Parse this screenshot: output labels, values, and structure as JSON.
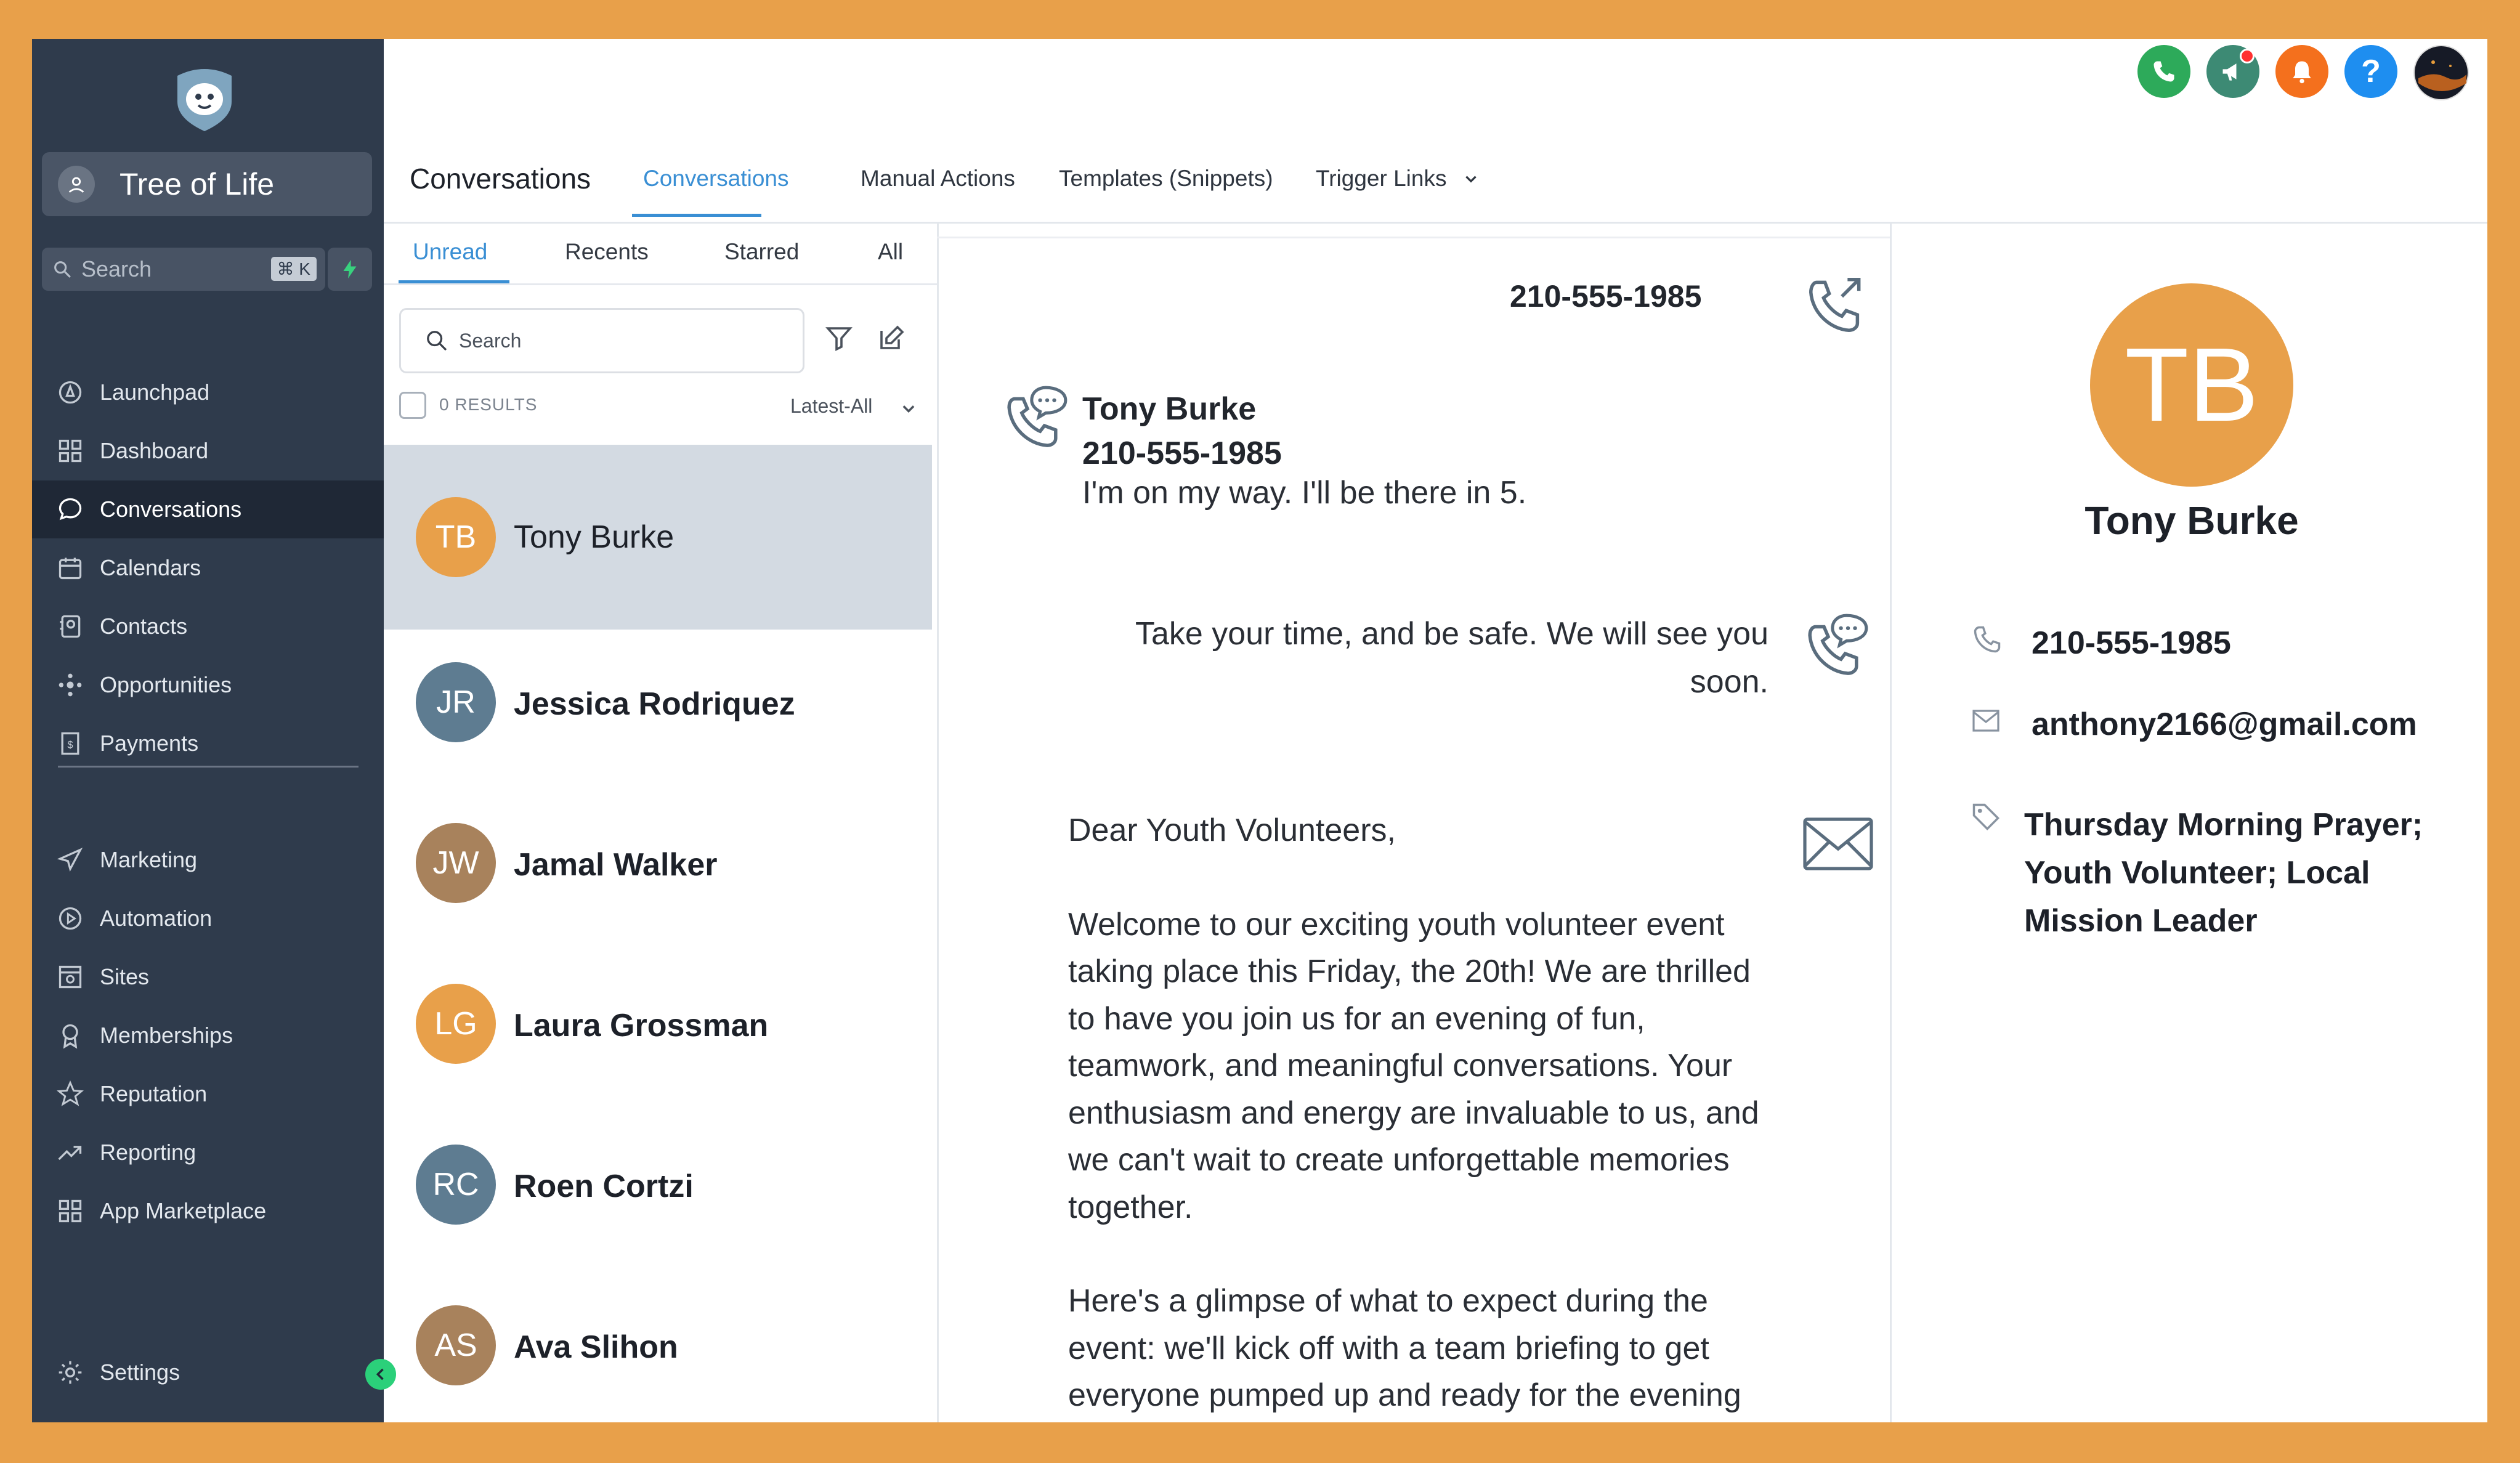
{
  "app": {
    "account_name": "Tree of Life",
    "search_placeholder": "Search",
    "search_shortcut": "⌘ K",
    "brand_accent": "#3a8fd4",
    "sidebar_bg": "#2F3B4C"
  },
  "sidebar": {
    "items": [
      {
        "label": "Launchpad",
        "icon": "rocket-icon"
      },
      {
        "label": "Dashboard",
        "icon": "grid-icon"
      },
      {
        "label": "Conversations",
        "icon": "chat-icon",
        "active": true
      },
      {
        "label": "Calendars",
        "icon": "calendar-icon"
      },
      {
        "label": "Contacts",
        "icon": "contacts-icon"
      },
      {
        "label": "Opportunities",
        "icon": "opportunities-icon"
      },
      {
        "label": "Payments",
        "icon": "payments-icon"
      },
      {
        "label": "Marketing",
        "icon": "send-icon"
      },
      {
        "label": "Automation",
        "icon": "automation-icon"
      },
      {
        "label": "Sites",
        "icon": "sites-icon"
      },
      {
        "label": "Memberships",
        "icon": "award-icon"
      },
      {
        "label": "Reputation",
        "icon": "star-icon"
      },
      {
        "label": "Reporting",
        "icon": "trend-icon"
      },
      {
        "label": "App Marketplace",
        "icon": "apps-icon"
      }
    ],
    "settings_label": "Settings"
  },
  "header": {
    "title": "Conversations",
    "tabs": [
      "Conversations",
      "Manual Actions",
      "Templates (Snippets)",
      "Trigger Links"
    ]
  },
  "list": {
    "tabs": [
      "Unread",
      "Recents",
      "Starred",
      "All"
    ],
    "search_placeholder": "Search",
    "results": "0 RESULTS",
    "sort": "Latest-All",
    "contacts": [
      {
        "initials": "TB",
        "name": "Tony Burke",
        "color": "#E8A04A"
      },
      {
        "initials": "JR",
        "name": "Jessica Rodriquez",
        "color": "#5E7C91"
      },
      {
        "initials": "JW",
        "name": "Jamal Walker",
        "color": "#A8825C"
      },
      {
        "initials": "LG",
        "name": "Laura Grossman",
        "color": "#E8A04A"
      },
      {
        "initials": "RC",
        "name": "Roen Cortzi",
        "color": "#5E7C91"
      },
      {
        "initials": "AS",
        "name": "Ava Slihon",
        "color": "#A8825C"
      }
    ]
  },
  "thread": {
    "phone": "210-555-1985",
    "sender_name": "Tony Burke",
    "sender_phone": "210-555-1985",
    "incoming": "I'm on my way. I'll be there in 5.",
    "reply_line1": "Take your time, and be safe. We will see you",
    "reply_line2": "soon.",
    "email_greeting": "Dear Youth Volunteers,",
    "email_p1": "Welcome to our exciting youth volunteer event taking place this Friday, the 20th! We are thrilled to have you join us for an evening of fun, teamwork, and meaningful conversations. Your enthusiasm and energy are invaluable to us, and we can't wait to create unforgettable memories together.",
    "email_p2": "Here's a glimpse of what to expect during the event: we'll kick off with a team briefing to get everyone pumped up and ready for the evening"
  },
  "details": {
    "initials": "TB",
    "name": "Tony Burke",
    "phone": "210-555-1985",
    "email": "anthony2166@gmail.com",
    "tags_line1": "Thursday Morning Prayer;",
    "tags_line2": "Youth Volunteer; Local",
    "tags_line3": "Mission Leader"
  }
}
